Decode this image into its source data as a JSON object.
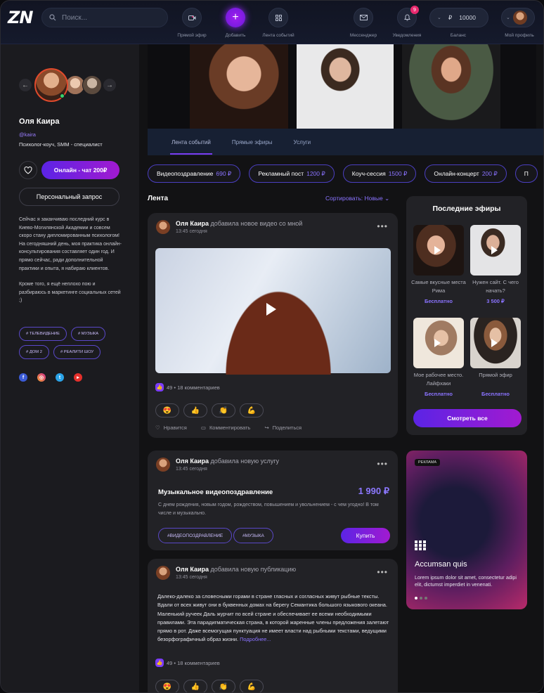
{
  "header": {
    "logo": "ZN",
    "search_placeholder": "Поиск...",
    "nav": [
      {
        "label": "Прямой эфир"
      },
      {
        "label": "Добавить"
      },
      {
        "label": "Лента событий"
      },
      {
        "label": "Мессенджер"
      },
      {
        "label": "Уведомления",
        "badge": "9"
      },
      {
        "label": "Баланс"
      },
      {
        "label": "Мой профиль"
      }
    ],
    "balance_currency": "₽",
    "balance_value": "10000"
  },
  "profile": {
    "name": "Оля Каира",
    "handle": "@kaira",
    "role": "Психолог-коуч, SMM - специалист",
    "chat_label": "Онлайн - чат  200₽",
    "request_label": "Персональный запрос",
    "bio1": "Сейчас я заканчиваю последний курс в Киево-Могилянской Академии и совсем скоро стану дипломированным психологом! На сегодняшний день, моя практика онлайн-консультирования составляет один год. И прямо сейчас, ради дополнительной практики и опыта, я набираю клиентов.",
    "bio2": "Кроме того, я ещё неплохо пою и разбираюсь в маркетинге социальных сетей ;)",
    "tags": [
      "# ТЕЛЕВИДЕНИЕ",
      "# МУЗЫКА",
      "# ДОМ 2",
      "# РЕАЛИТИ ШОУ"
    ]
  },
  "tabs": [
    "Лента событий",
    "Прямые эфиры",
    "Услуги"
  ],
  "services": [
    {
      "name": "Видеопоздравление",
      "price": "690 ₽"
    },
    {
      "name": "Рекламный пост",
      "price": "1200 ₽"
    },
    {
      "name": "Коуч-сессия",
      "price": "1500 ₽"
    },
    {
      "name": "Онлайн-концерт",
      "price": "200 ₽"
    },
    {
      "name": "П",
      "price": ""
    }
  ],
  "feed": {
    "title": "Лента",
    "sort_prefix": "Сортировать:",
    "sort_value": "Новые"
  },
  "post1": {
    "author": "Оля Каира",
    "action": "добавила новое видео со мной",
    "time": "13:45 сегодня",
    "stats": "49 • 18 комментариев",
    "like": "Нравится",
    "comment": "Комментировать",
    "share": "Поделиться"
  },
  "post2": {
    "author": "Оля Каира",
    "action": "добавила новую услугу",
    "time": "13:45 сегодня",
    "title": "Музыкальное видеопоздравление",
    "price": "1 990 ₽",
    "desc": "С днем рождения, новым годом, рождеством, повышением и увольнением - с чем угодно! В том числе и музыкально.",
    "chip1": "#ВИДЕОПОЗДРАВЛЕНИЕ",
    "chip2": "#МУЗЫКА",
    "buy": "Купить"
  },
  "post3": {
    "author": "Оля Каира",
    "action": "добавила новую публикацию",
    "time": "13:45 сегодня",
    "text": "Далеко-далеко за словесными горами в стране гласных и согласных живут рыбные тексты. Вдали от всех живут они в буквенных домах на берегу Семантика большого языкового океана. Маленький ручеек Даль журчит по всей стране и обеспечивает ее всеми необходимыми правилами. Эта парадигматическая страна, в которой жаренные члены предложения залетают прямо в рот. Даже всемогущая пунктуация не имеет власти над рыбными текстами, ведущими безорфографичный образ жизни.",
    "more": "Подробнее...",
    "stats": "49 • 18 комментариев"
  },
  "streams": {
    "title": "Последние эфиры",
    "items": [
      {
        "caption": "Самые вкусные места Рима",
        "price": "Бесплатно"
      },
      {
        "caption": "Нужен сайт. С чего начать?",
        "price": "3 500 ₽"
      },
      {
        "caption": "Мое рабочее место. Лайфхаки",
        "price": "Бесплатно"
      },
      {
        "caption": "Прямой эфир",
        "price": "Бесплатно"
      }
    ],
    "watch_all": "Смотреть все"
  },
  "ad": {
    "label": "РЕКЛАМА",
    "title": "Accumsan quis",
    "desc": "Lorem ipsum dolor sit amet, consectetur adipi elit, dictumst imperdiet in venenati."
  },
  "colors": {
    "accent": "#7a3cf0",
    "accent2": "#a21ad0",
    "price": "#8a73ff",
    "topbar": "#131829"
  }
}
